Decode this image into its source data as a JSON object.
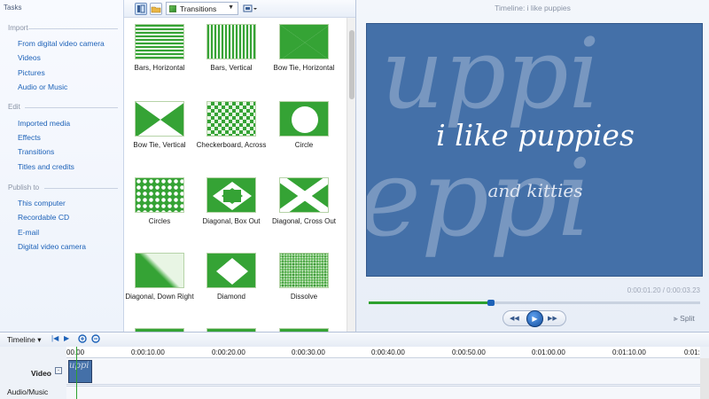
{
  "tasks": {
    "title": "Tasks",
    "sections": [
      {
        "header": "Import",
        "links": [
          "From digital video camera",
          "Videos",
          "Pictures",
          "Audio or Music"
        ]
      },
      {
        "header": "Edit",
        "links": [
          "Imported media",
          "Effects",
          "Transitions",
          "Titles and credits"
        ]
      },
      {
        "header": "Publish to",
        "links": [
          "This computer",
          "Recordable CD",
          "E-mail",
          "Digital video camera"
        ]
      }
    ]
  },
  "collection": {
    "dropdown_value": "Transitions",
    "items": [
      "Bars, Horizontal",
      "Bars, Vertical",
      "Bow Tie, Horizontal",
      "Bow Tie, Vertical",
      "Checkerboard, Across",
      "Circle",
      "Circles",
      "Diagonal, Box Out",
      "Diagonal, Cross Out",
      "Diagonal, Down Right",
      "Diamond",
      "Dissolve"
    ]
  },
  "preview": {
    "title": "Timeline: i like puppies",
    "main_text": "i like puppies",
    "sub_text": "and kitties",
    "watermark_top": "uppi",
    "watermark_bottom": "eppi",
    "time": "0:00:01.20 / 0:00:03.23",
    "progress_fraction": 0.37,
    "split_label": "Split"
  },
  "timeline": {
    "label": "Timeline",
    "ticks": [
      "00.00",
      "0:00:10.00",
      "0:00:20.00",
      "0:00:30.00",
      "0:00:40.00",
      "0:00:50.00",
      "0:01:00.00",
      "0:01:10.00",
      "0:01:20.00"
    ],
    "video_track": "Video",
    "audio_track": "Audio/Music",
    "clip_text": "uppi"
  },
  "colors": {
    "accent_blue": "#1d62b8",
    "transition_green": "#35a335",
    "preview_bg": "#4470a8"
  }
}
